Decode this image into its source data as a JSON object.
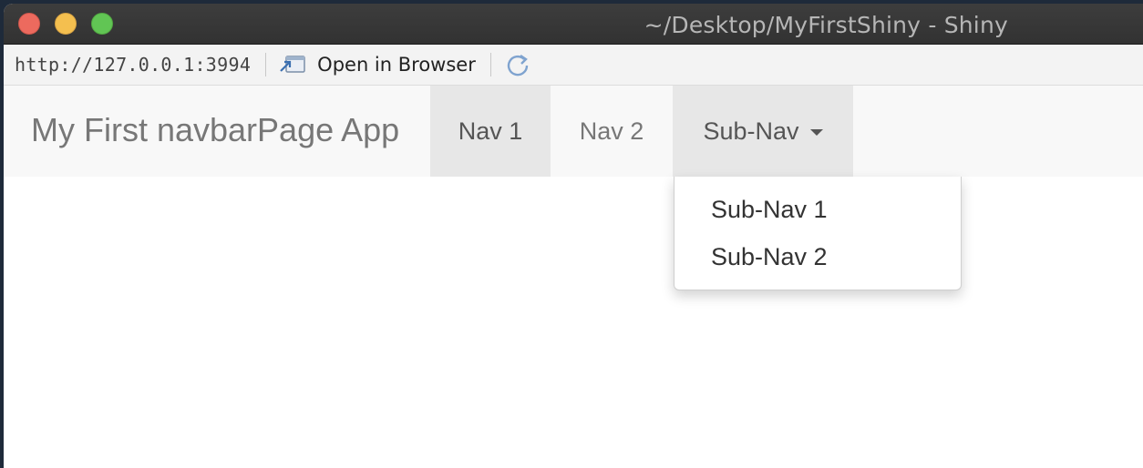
{
  "window": {
    "title": "~/Desktop/MyFirstShiny - Shiny"
  },
  "addressbar": {
    "url": "http://127.0.0.1:3994",
    "open_in_browser_label": "Open in Browser",
    "open_icon": "open-in-browser-icon",
    "refresh_icon": "refresh-icon"
  },
  "navbar": {
    "brand": "My First navbarPage App",
    "items": [
      {
        "label": "Nav 1",
        "state": "active"
      },
      {
        "label": "Nav 2",
        "state": "normal"
      },
      {
        "label": "Sub-Nav",
        "state": "open"
      }
    ],
    "dropdown": {
      "items": [
        {
          "label": "Sub-Nav 1"
        },
        {
          "label": "Sub-Nav 2"
        }
      ]
    }
  },
  "colors": {
    "navbar_bg": "#f8f8f8",
    "active_bg": "#e7e7e7",
    "close": "#ec6a5e",
    "minimize": "#f4bf4f",
    "maximize": "#61c554"
  }
}
